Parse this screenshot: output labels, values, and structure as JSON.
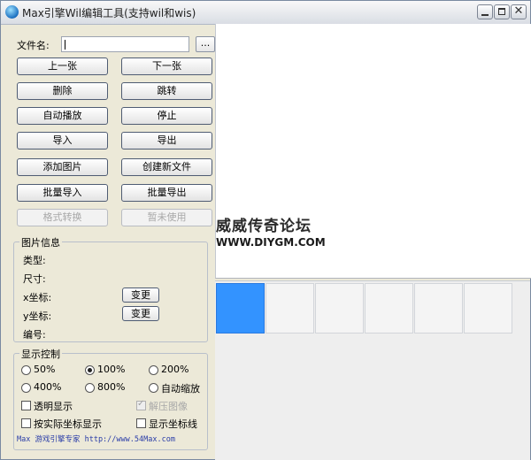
{
  "window": {
    "title": "Max引擎Wil编辑工具(支持wil和wis)"
  },
  "file": {
    "label": "文件名:",
    "value": "",
    "browse_label": "..."
  },
  "buttons": {
    "prev": "上一张",
    "next": "下一张",
    "delete": "删除",
    "jump": "跳转",
    "autoplay": "自动播放",
    "stop": "停止",
    "import": "导入",
    "export": "导出",
    "add_image": "添加图片",
    "create_file": "创建新文件",
    "batch_import": "批量导入",
    "batch_export": "批量导出",
    "format_convert": "格式转换",
    "not_in_use": "暂未使用"
  },
  "image_info": {
    "title": "图片信息",
    "type_label": "类型:",
    "size_label": "尺寸:",
    "x_label": "x坐标:",
    "y_label": "y坐标:",
    "index_label": "编号:",
    "change_label": "变更"
  },
  "display": {
    "title": "显示控制",
    "zoom_options": [
      "50%",
      "100%",
      "200%",
      "400%",
      "800%",
      "自动缩放"
    ],
    "selected_zoom": "100%",
    "transparent_label": "透明显示",
    "transparent_checked": false,
    "decompress_label": "解压图像",
    "decompress_checked": true,
    "decompress_enabled": false,
    "actual_coords_label": "按实际坐标显示",
    "actual_coords_checked": false,
    "coord_lines_label": "显示坐标线",
    "coord_lines_checked": false
  },
  "footer": {
    "text": "Max 游戏引擎专家 http://www.54Max.com"
  },
  "watermark": {
    "line1": "威威传奇论坛",
    "line2": "WWW.DIYGM.COM"
  },
  "thumbnails": {
    "count": 6,
    "selected_index": 0
  },
  "colors": {
    "selection": "#3393ff",
    "footer_link": "#2a3da8",
    "window_bg": "#ece9d8"
  }
}
